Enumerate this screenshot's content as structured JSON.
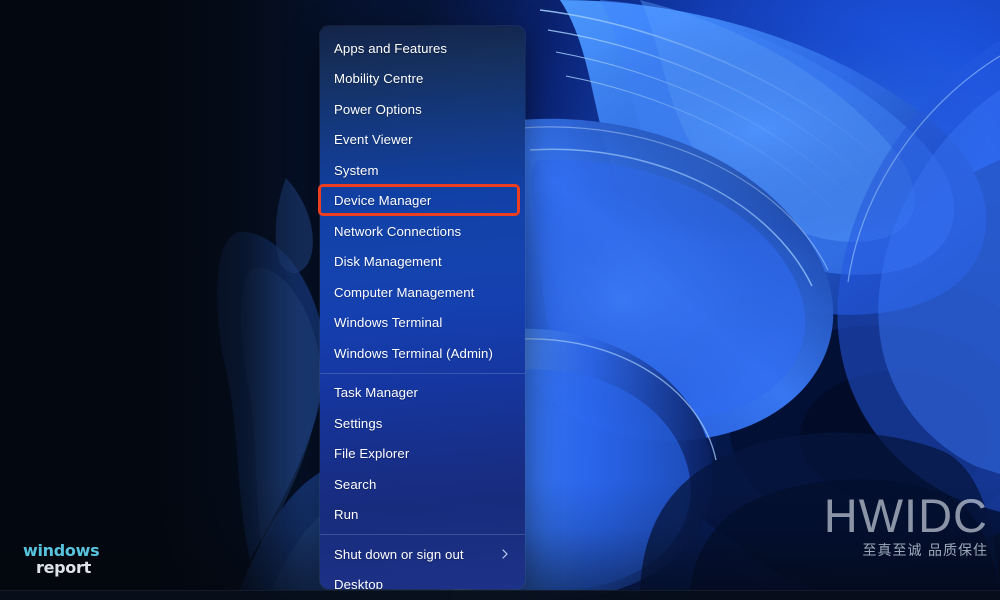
{
  "desktop": {
    "wallpaper_name": "windows-11-bloom-wallpaper",
    "taskbar_name": "taskbar"
  },
  "watermarks": {
    "windows_report": {
      "line1": "windows",
      "line2": "report",
      "line1_color": "#5fd3ef",
      "line2_color": "#f2f6fa"
    },
    "hwidc": {
      "main": "HWIDC",
      "sub": "至真至诚 品质保住"
    }
  },
  "context_menu": {
    "name": "winx-power-user-menu",
    "items": [
      {
        "label": "Apps and Features",
        "key": "apps-and-features",
        "separator_before": false,
        "submenu": false
      },
      {
        "label": "Mobility Centre",
        "key": "mobility-centre",
        "separator_before": false,
        "submenu": false
      },
      {
        "label": "Power Options",
        "key": "power-options",
        "separator_before": false,
        "submenu": false
      },
      {
        "label": "Event Viewer",
        "key": "event-viewer",
        "separator_before": false,
        "submenu": false
      },
      {
        "label": "System",
        "key": "system",
        "separator_before": false,
        "submenu": false
      },
      {
        "label": "Device Manager",
        "key": "device-manager",
        "separator_before": false,
        "submenu": false
      },
      {
        "label": "Network Connections",
        "key": "network-connections",
        "separator_before": false,
        "submenu": false
      },
      {
        "label": "Disk Management",
        "key": "disk-management",
        "separator_before": false,
        "submenu": false
      },
      {
        "label": "Computer Management",
        "key": "computer-management",
        "separator_before": false,
        "submenu": false
      },
      {
        "label": "Windows Terminal",
        "key": "windows-terminal",
        "separator_before": false,
        "submenu": false
      },
      {
        "label": "Windows Terminal (Admin)",
        "key": "windows-terminal-admin",
        "separator_before": false,
        "submenu": false
      },
      {
        "label": "Task Manager",
        "key": "task-manager",
        "separator_before": true,
        "submenu": false
      },
      {
        "label": "Settings",
        "key": "settings",
        "separator_before": false,
        "submenu": false
      },
      {
        "label": "File Explorer",
        "key": "file-explorer",
        "separator_before": false,
        "submenu": false
      },
      {
        "label": "Search",
        "key": "search",
        "separator_before": false,
        "submenu": false
      },
      {
        "label": "Run",
        "key": "run",
        "separator_before": false,
        "submenu": false
      },
      {
        "label": "Shut down or sign out",
        "key": "shut-down-or-sign-out",
        "separator_before": true,
        "submenu": true
      },
      {
        "label": "Desktop",
        "key": "desktop",
        "separator_before": false,
        "submenu": false
      }
    ]
  },
  "annotation": {
    "highlight_target": "Device Manager",
    "highlight_color": "#ec3f21"
  }
}
